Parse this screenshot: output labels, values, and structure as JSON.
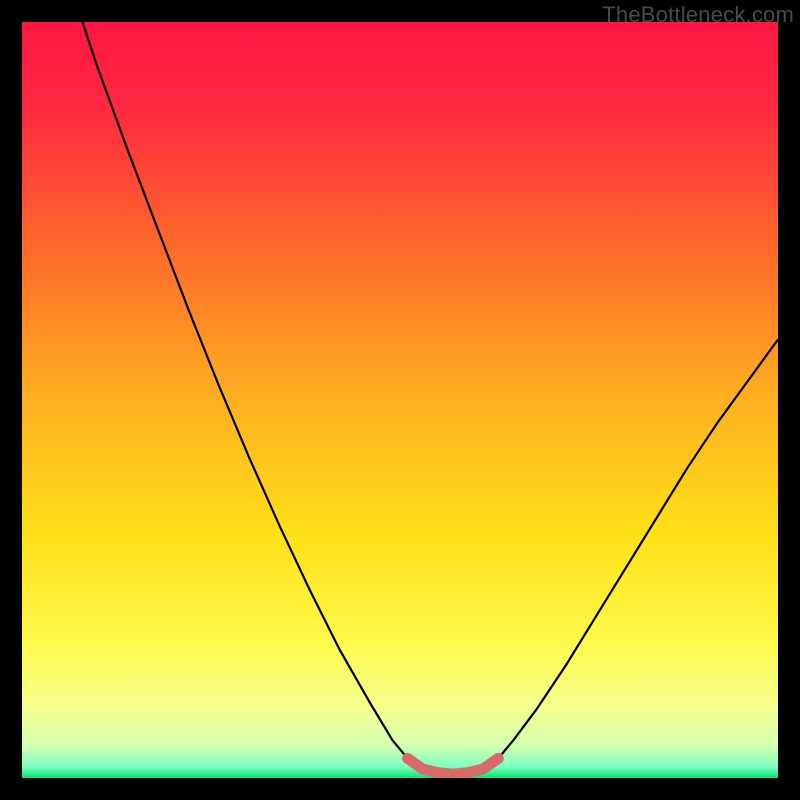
{
  "watermark": "TheBottleneck.com",
  "chart_data": {
    "type": "line",
    "title": "",
    "xlabel": "",
    "ylabel": "",
    "xlim": [
      0,
      100
    ],
    "ylim": [
      0,
      100
    ],
    "grid": false,
    "gradient_stops": [
      {
        "offset": 0.0,
        "color": "#ff1744"
      },
      {
        "offset": 0.12,
        "color": "#ff2a3f"
      },
      {
        "offset": 0.3,
        "color": "#ff6a2a"
      },
      {
        "offset": 0.5,
        "color": "#ffb020"
      },
      {
        "offset": 0.68,
        "color": "#ffe018"
      },
      {
        "offset": 0.82,
        "color": "#fff94a"
      },
      {
        "offset": 0.9,
        "color": "#f7ff8a"
      },
      {
        "offset": 0.955,
        "color": "#d8ffb0"
      },
      {
        "offset": 0.985,
        "color": "#7dffc0"
      },
      {
        "offset": 1.0,
        "color": "#00e676"
      }
    ],
    "series": [
      {
        "name": "curve",
        "stroke": "#000000",
        "stroke_width": 2.2,
        "points": [
          {
            "x": 8.0,
            "y": 100.0
          },
          {
            "x": 10.0,
            "y": 94.0
          },
          {
            "x": 14.0,
            "y": 83.0
          },
          {
            "x": 18.0,
            "y": 72.5
          },
          {
            "x": 22.0,
            "y": 62.0
          },
          {
            "x": 26.0,
            "y": 52.0
          },
          {
            "x": 30.0,
            "y": 42.5
          },
          {
            "x": 34.0,
            "y": 33.5
          },
          {
            "x": 38.0,
            "y": 25.0
          },
          {
            "x": 42.0,
            "y": 17.0
          },
          {
            "x": 46.0,
            "y": 10.0
          },
          {
            "x": 49.0,
            "y": 5.0
          },
          {
            "x": 51.5,
            "y": 2.0
          },
          {
            "x": 54.0,
            "y": 0.8
          },
          {
            "x": 57.0,
            "y": 0.5
          },
          {
            "x": 60.0,
            "y": 0.8
          },
          {
            "x": 62.5,
            "y": 2.0
          },
          {
            "x": 65.0,
            "y": 5.0
          },
          {
            "x": 68.0,
            "y": 9.0
          },
          {
            "x": 72.0,
            "y": 15.0
          },
          {
            "x": 76.0,
            "y": 21.5
          },
          {
            "x": 80.0,
            "y": 28.0
          },
          {
            "x": 84.0,
            "y": 34.5
          },
          {
            "x": 88.0,
            "y": 41.0
          },
          {
            "x": 92.0,
            "y": 47.0
          },
          {
            "x": 96.0,
            "y": 52.5
          },
          {
            "x": 100.0,
            "y": 58.0
          }
        ]
      },
      {
        "name": "segment-highlight",
        "stroke": "#d86a6a",
        "stroke_width": 11,
        "linecap": "round",
        "points": [
          {
            "x": 51.0,
            "y": 2.6
          },
          {
            "x": 53.0,
            "y": 1.2
          },
          {
            "x": 55.0,
            "y": 0.7
          },
          {
            "x": 57.0,
            "y": 0.5
          },
          {
            "x": 59.0,
            "y": 0.7
          },
          {
            "x": 61.0,
            "y": 1.2
          },
          {
            "x": 63.0,
            "y": 2.6
          }
        ]
      }
    ]
  }
}
